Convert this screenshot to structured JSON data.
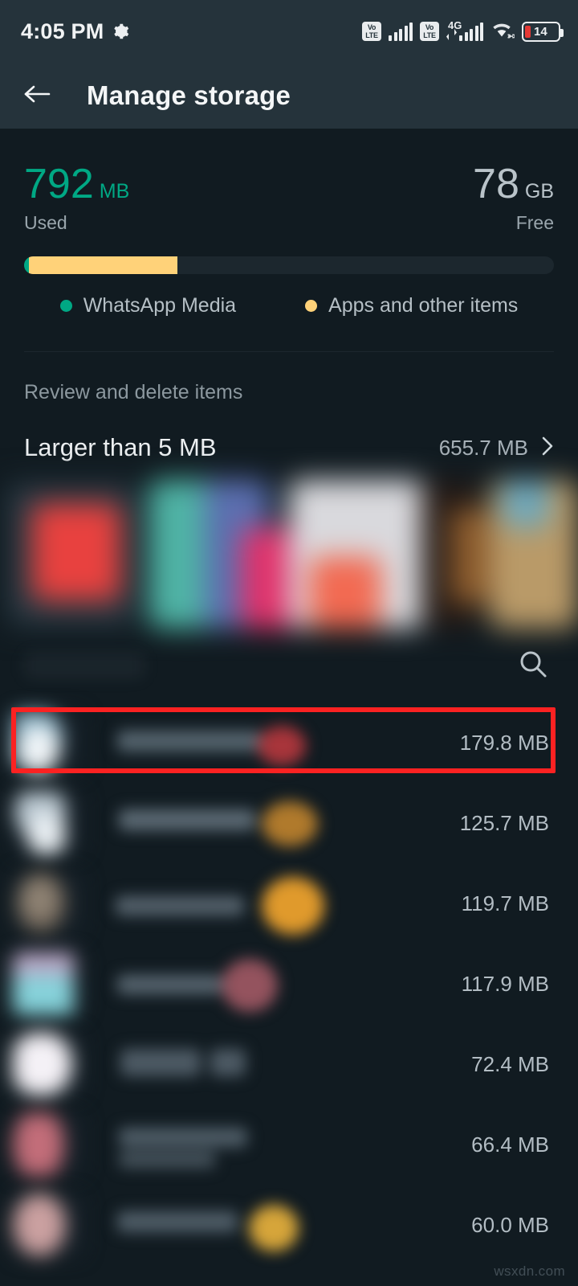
{
  "status_bar": {
    "time": "4:05 PM",
    "gear_icon": "gear-icon",
    "volte_top": "Vo",
    "volte_bottom": "LTE",
    "network_label": "4G",
    "battery_level": "14",
    "wifi_icon": "wifi-icon",
    "signal_icon": "signal-bars-icon"
  },
  "app_bar": {
    "back_icon": "back-arrow-icon",
    "title": "Manage storage"
  },
  "storage": {
    "used_value": "792",
    "used_unit": "MB",
    "used_caption": "Used",
    "free_value": "78",
    "free_unit": "GB",
    "free_caption": "Free",
    "bar": {
      "media_percent": 0.9,
      "apps_percent": 28.0,
      "media_color": "#00a884",
      "apps_color": "#ffd279",
      "track_color": "#1c272e"
    },
    "legend": [
      {
        "label": "WhatsApp Media",
        "color": "#00a884"
      },
      {
        "label": "Apps and other items",
        "color": "#ffd279"
      }
    ]
  },
  "review": {
    "section_title": "Review and delete items",
    "larger_than": {
      "label": "Larger than 5 MB",
      "size": "655.7 MB",
      "chevron_icon": "chevron-right-icon"
    }
  },
  "toolbar": {
    "search_icon": "search-icon"
  },
  "files": [
    {
      "size": "179.8 MB",
      "highlighted": true
    },
    {
      "size": "125.7 MB",
      "highlighted": false
    },
    {
      "size": "119.7 MB",
      "highlighted": false
    },
    {
      "size": "117.9 MB",
      "highlighted": false
    },
    {
      "size": "72.4 MB",
      "highlighted": false
    },
    {
      "size": "66.4 MB",
      "highlighted": false
    },
    {
      "size": "60.0 MB",
      "highlighted": false
    }
  ],
  "annotation": {
    "color": "#fb2222",
    "target": "file-row-0"
  },
  "watermark": "wsxdn.com"
}
